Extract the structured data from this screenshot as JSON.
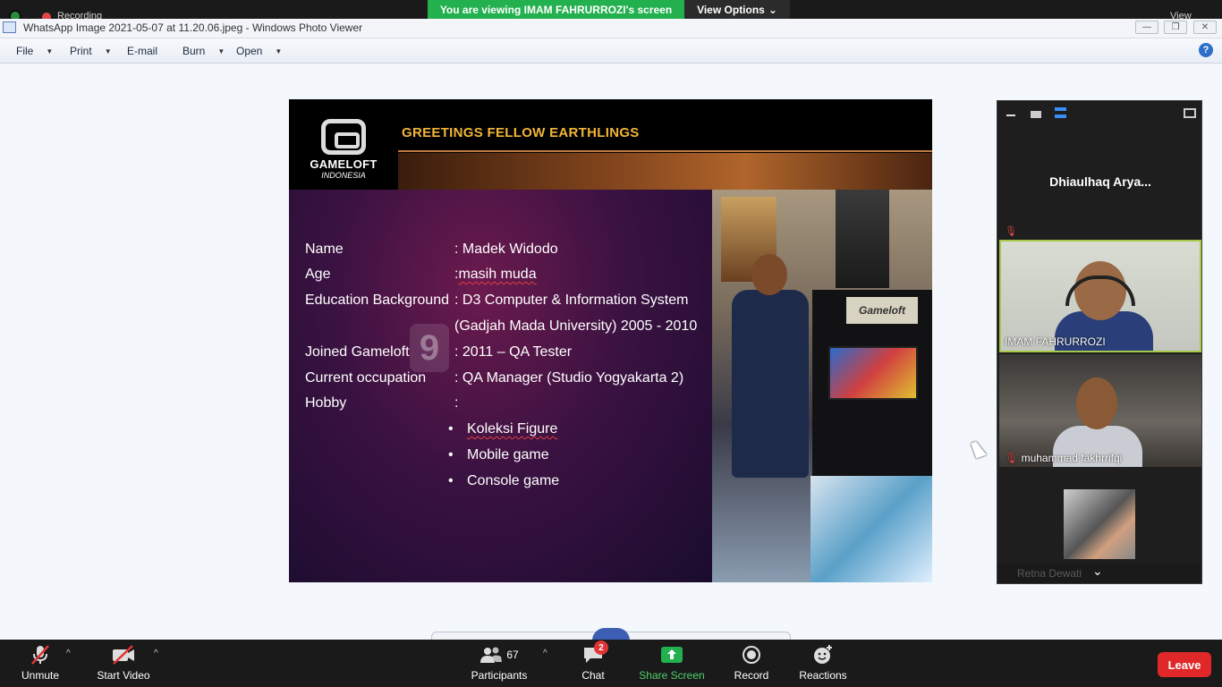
{
  "zoom_top": {
    "recording_label": "Recording",
    "viewing_banner": "You are viewing IMAM FAHRURROZI's screen",
    "view_options_label": "View Options",
    "view_label": "View"
  },
  "photo_viewer": {
    "title": "WhatsApp Image 2021-05-07 at 11.20.06.jpeg - Windows Photo Viewer",
    "menu": [
      {
        "label": "File",
        "has_dropdown": true
      },
      {
        "label": "Print",
        "has_dropdown": true
      },
      {
        "label": "E-mail",
        "has_dropdown": false
      },
      {
        "label": "Burn",
        "has_dropdown": true
      },
      {
        "label": "Open",
        "has_dropdown": true
      }
    ],
    "help_label": "?"
  },
  "slide": {
    "logo_name": "GAMELOFT",
    "logo_sub": "INDONESIA",
    "heading": "GREETINGS FELLOW EARTHLINGS",
    "rows": [
      {
        "label": "Name",
        "value": ": Madek Widodo"
      },
      {
        "label": "Age",
        "value_prefix": ": ",
        "value": "masih muda"
      },
      {
        "label": "Education Background",
        "value": ": D3 Computer & Information System"
      },
      {
        "label": "",
        "value": "(Gadjah Mada University) 2005 - 2010"
      },
      {
        "label": "Joined Gameloft",
        "value": ": 2011 – QA Tester"
      },
      {
        "label": "Current occupation",
        "value": ": QA Manager (Studio Yogyakarta 2)"
      },
      {
        "label": "Hobby",
        "value": ":"
      }
    ],
    "hobbies": [
      "Koleksi Figure",
      "Mobile game",
      "Console game"
    ],
    "big_badge": "9",
    "photo_sign": "Gameloft"
  },
  "zoom_panel": {
    "speaker_name": "Dhiaulhaq Arya...",
    "participants": [
      {
        "name": "IMAM FAHRURROZI",
        "muted": false,
        "active": true
      },
      {
        "name": "muhammad fakhrrifqi",
        "muted": true,
        "active": false
      }
    ],
    "footer_name": "Retna Dewati"
  },
  "toolbar": {
    "unmute": "Unmute",
    "start_video": "Start Video",
    "participants_label": "Participants",
    "participants_count": "67",
    "chat_label": "Chat",
    "chat_badge": "2",
    "share_screen": "Share Screen",
    "record": "Record",
    "reactions": "Reactions",
    "leave": "Leave"
  },
  "colors": {
    "zoom_green": "#23b04f",
    "slide_heading": "#f2b53a",
    "leave_red": "#e02828",
    "active_border": "#a7c94a"
  }
}
